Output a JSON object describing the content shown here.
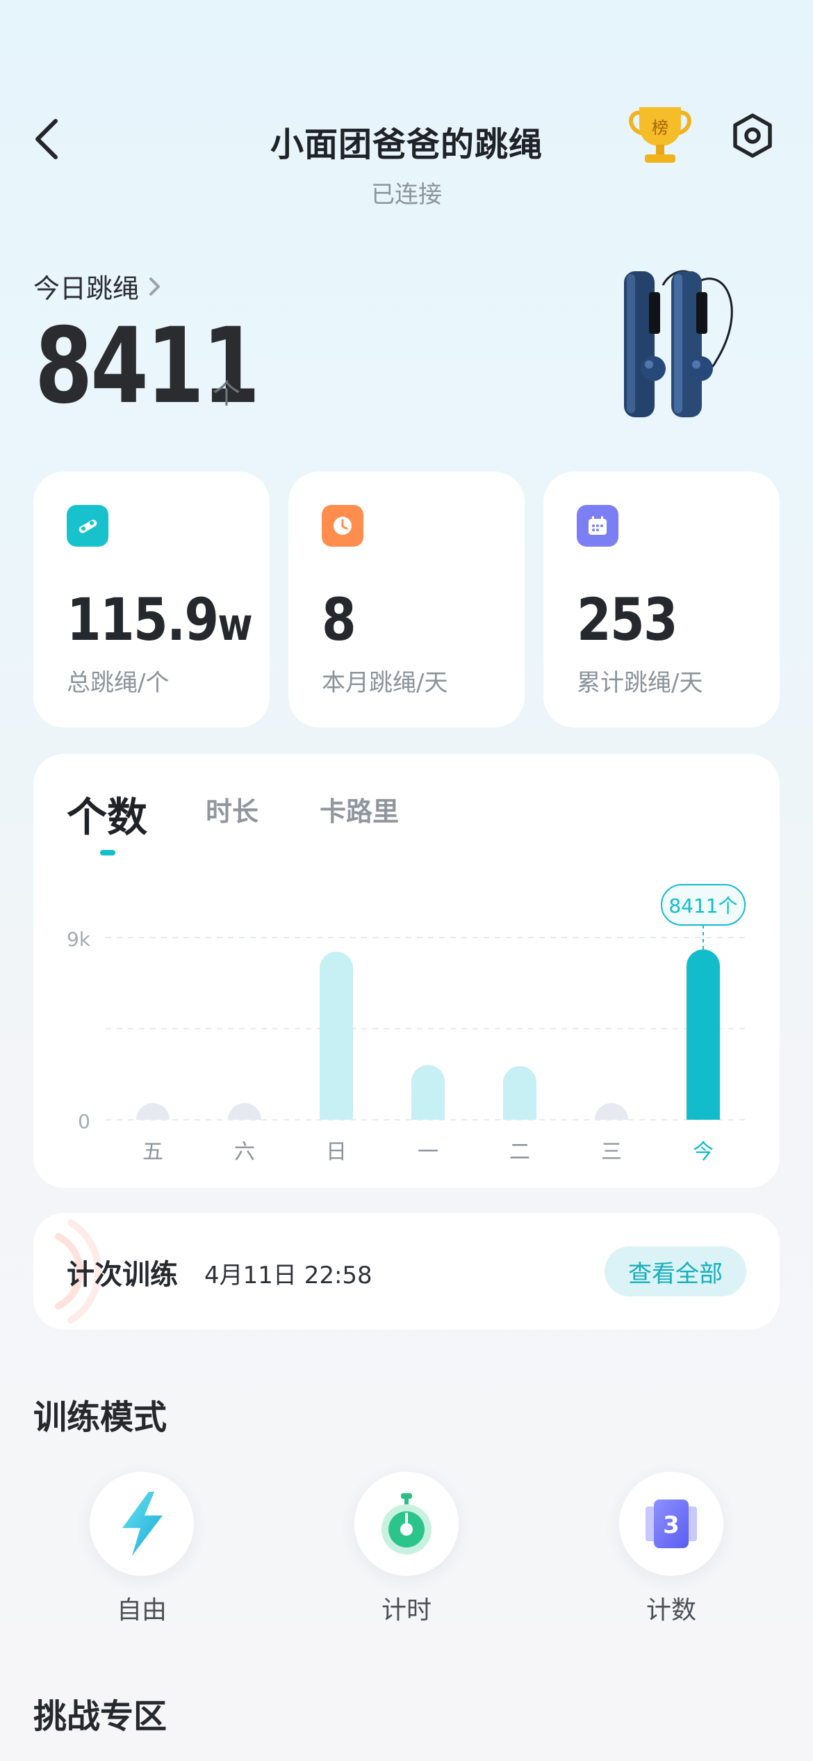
{
  "header": {
    "title": "小面团爸爸的跳绳",
    "status": "已连接",
    "trophy_text": "榜"
  },
  "today": {
    "label": "今日跳绳",
    "value": "8411",
    "unit": "个"
  },
  "stats": [
    {
      "value": "115.9",
      "suffix": "w",
      "label": "总跳绳/个",
      "icon": "rope-icon",
      "color": "#17c2cc"
    },
    {
      "value": "8",
      "suffix": "",
      "label": "本月跳绳/天",
      "icon": "clock-icon",
      "color": "#ff8d4e"
    },
    {
      "value": "253",
      "suffix": "",
      "label": "累计跳绳/天",
      "icon": "calendar-icon",
      "color": "#7b7ff3"
    }
  ],
  "chart_tabs": [
    "个数",
    "时长",
    "卡路里"
  ],
  "chart_data": {
    "type": "bar",
    "categories": [
      "五",
      "六",
      "日",
      "一",
      "二",
      "三",
      "今"
    ],
    "values": [
      0,
      0,
      8300,
      2700,
      2650,
      0,
      8411
    ],
    "ylim": [
      0,
      9000
    ],
    "yticks": [
      "0",
      "9k"
    ],
    "highlight_label": "8411个",
    "highlight_index": 6,
    "colors": {
      "highlight": "#12bccb",
      "normal": "#c6f0f3",
      "empty": "#e6e9f0"
    }
  },
  "record": {
    "title": "计次训练",
    "time": "4月11日 22:58",
    "view_all": "查看全部"
  },
  "modes_title": "训练模式",
  "modes": [
    {
      "label": "自由",
      "icon": "lightning-icon"
    },
    {
      "label": "计时",
      "icon": "stopwatch-icon"
    },
    {
      "label": "计数",
      "icon": "counter-icon",
      "icon_text": "3"
    }
  ],
  "challenge_title": "挑战专区"
}
